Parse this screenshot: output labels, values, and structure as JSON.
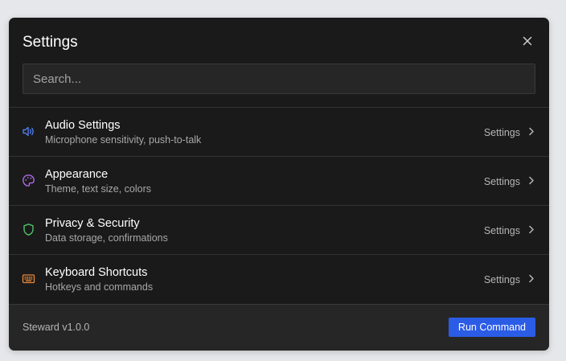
{
  "dialog": {
    "title": "Settings"
  },
  "search": {
    "placeholder": "Search..."
  },
  "items": [
    {
      "label": "Audio Settings",
      "desc": "Microphone sensitivity, push-to-talk",
      "action": "Settings",
      "icon": "speaker-icon",
      "color": "#4f7cf0"
    },
    {
      "label": "Appearance",
      "desc": "Theme, text size, colors",
      "action": "Settings",
      "icon": "palette-icon",
      "color": "#b06ae8"
    },
    {
      "label": "Privacy & Security",
      "desc": "Data storage, confirmations",
      "action": "Settings",
      "icon": "shield-icon",
      "color": "#4ec26a"
    },
    {
      "label": "Keyboard Shortcuts",
      "desc": "Hotkeys and commands",
      "action": "Settings",
      "icon": "keyboard-icon",
      "color": "#e88a3a"
    }
  ],
  "footer": {
    "version": "Steward v1.0.0",
    "run_label": "Run Command",
    "run_color": "#2b5ce6"
  }
}
